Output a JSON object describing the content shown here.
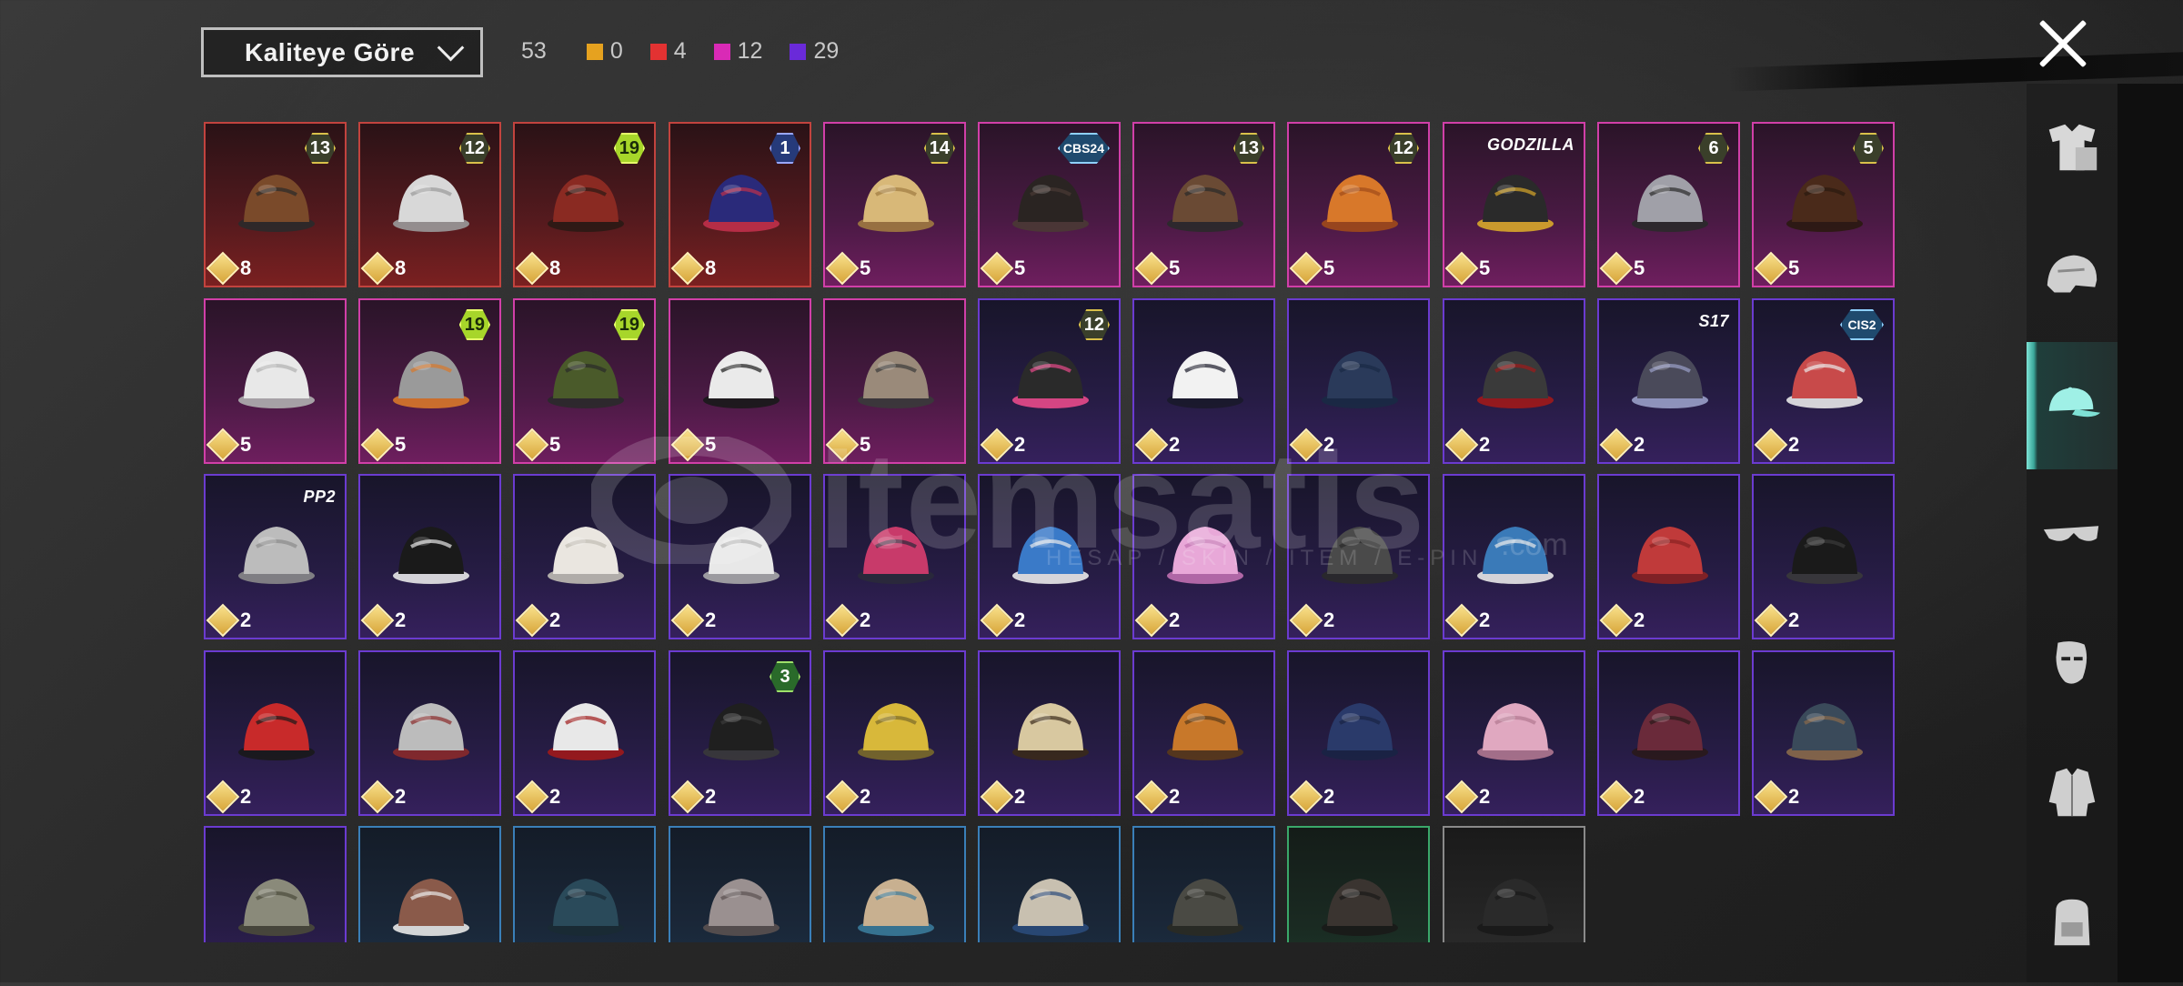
{
  "toolbar": {
    "sort_label": "Kaliteye Göre",
    "total_count": "53",
    "quality_counts": [
      {
        "color": "#e6a21f",
        "count": "0"
      },
      {
        "color": "#e33232",
        "count": "4"
      },
      {
        "color": "#d92ab6",
        "count": "12"
      },
      {
        "color": "#6a2ad9",
        "count": "29"
      }
    ]
  },
  "watermark": {
    "brand": "itemsatis",
    "sub": "HESAP / SKIN / ITEM / E-PIN",
    "domain": ".com"
  },
  "sidebar": {
    "items": [
      {
        "icon": "outfit-icon",
        "active": false
      },
      {
        "icon": "helmet-icon",
        "active": false
      },
      {
        "icon": "cap-icon",
        "active": true
      },
      {
        "icon": "glasses-icon",
        "active": false
      },
      {
        "icon": "mask-icon",
        "active": false
      },
      {
        "icon": "jacket-icon",
        "active": false
      },
      {
        "icon": "backpack-icon",
        "active": false
      }
    ]
  },
  "items": [
    {
      "row": 0,
      "col": 0,
      "rarity": "red",
      "badge": "13",
      "badge_style": "gold",
      "price": "8",
      "art": "brown-hat-hair"
    },
    {
      "row": 0,
      "col": 1,
      "rarity": "red",
      "badge": "12",
      "badge_style": "gold",
      "price": "8",
      "art": "white-hair"
    },
    {
      "row": 0,
      "col": 2,
      "rarity": "red",
      "badge": "19",
      "badge_style": "lime",
      "price": "8",
      "art": "samurai-helmet"
    },
    {
      "row": 0,
      "col": 3,
      "rarity": "red",
      "badge": "1",
      "badge_style": "blue",
      "price": "8",
      "art": "blue-helmet"
    },
    {
      "row": 0,
      "col": 4,
      "rarity": "pink",
      "badge": "14",
      "badge_style": "gold",
      "price": "5",
      "art": "blonde-hair"
    },
    {
      "row": 0,
      "col": 5,
      "rarity": "pink",
      "badge": "CBS24",
      "badge_style": "cbs",
      "price": "5",
      "art": "black-hair"
    },
    {
      "row": 0,
      "col": 6,
      "rarity": "pink",
      "badge": "13",
      "badge_style": "gold",
      "price": "5",
      "art": "goggles-hair"
    },
    {
      "row": 0,
      "col": 7,
      "rarity": "pink",
      "badge": "12",
      "badge_style": "gold",
      "price": "5",
      "art": "orange-hair"
    },
    {
      "row": 0,
      "col": 8,
      "rarity": "pink",
      "badge": "GODZILLA",
      "badge_style": "text",
      "price": "5",
      "art": "spiked-cap"
    },
    {
      "row": 0,
      "col": 9,
      "rarity": "pink",
      "badge": "6",
      "badge_style": "gold",
      "price": "5",
      "art": "silver-helmet"
    },
    {
      "row": 0,
      "col": 10,
      "rarity": "pink",
      "badge": "5",
      "badge_style": "gold",
      "price": "5",
      "art": "pigtails"
    },
    {
      "row": 1,
      "col": 0,
      "rarity": "pink",
      "badge": "",
      "badge_style": "",
      "price": "5",
      "art": "white-braid"
    },
    {
      "row": 1,
      "col": 1,
      "rarity": "pink",
      "badge": "19",
      "badge_style": "lime",
      "price": "5",
      "art": "cat-headphones"
    },
    {
      "row": 1,
      "col": 2,
      "rarity": "pink",
      "badge": "19",
      "badge_style": "lime",
      "price": "5",
      "art": "frog-head"
    },
    {
      "row": 1,
      "col": 3,
      "rarity": "pink",
      "badge": "",
      "badge_style": "",
      "price": "5",
      "art": "piano-hat"
    },
    {
      "row": 1,
      "col": 4,
      "rarity": "pink",
      "badge": "",
      "badge_style": "",
      "price": "5",
      "art": "skull-hair"
    },
    {
      "row": 1,
      "col": 5,
      "rarity": "purple",
      "badge": "12",
      "badge_style": "gold",
      "price": "2",
      "art": "bunny-helmet"
    },
    {
      "row": 1,
      "col": 6,
      "rarity": "purple",
      "badge": "",
      "badge_style": "",
      "price": "2",
      "art": "sun-hat"
    },
    {
      "row": 1,
      "col": 7,
      "rarity": "purple",
      "badge": "",
      "badge_style": "",
      "price": "2",
      "art": "blue-beanie"
    },
    {
      "row": 1,
      "col": 8,
      "rarity": "purple",
      "badge": "",
      "badge_style": "",
      "price": "2",
      "art": "bucket-hat"
    },
    {
      "row": 1,
      "col": 9,
      "rarity": "purple",
      "badge": "S17",
      "badge_style": "text",
      "price": "2",
      "art": "horned-helmet"
    },
    {
      "row": 1,
      "col": 10,
      "rarity": "purple",
      "badge": "CIS2",
      "badge_style": "cbs",
      "price": "2",
      "art": "flag-cap"
    },
    {
      "row": 2,
      "col": 0,
      "rarity": "purple",
      "badge": "PP2",
      "badge_style": "text",
      "price": "2",
      "art": "silver-bob"
    },
    {
      "row": 2,
      "col": 1,
      "rarity": "purple",
      "badge": "",
      "badge_style": "",
      "price": "2",
      "art": "black-braids"
    },
    {
      "row": 2,
      "col": 2,
      "rarity": "purple",
      "badge": "",
      "badge_style": "",
      "price": "2",
      "art": "knit-beanie"
    },
    {
      "row": 2,
      "col": 3,
      "rarity": "purple",
      "badge": "",
      "badge_style": "",
      "price": "2",
      "art": "white-hood"
    },
    {
      "row": 2,
      "col": 4,
      "rarity": "purple",
      "badge": "",
      "badge_style": "",
      "price": "2",
      "art": "moto-helmet"
    },
    {
      "row": 2,
      "col": 5,
      "rarity": "purple",
      "badge": "",
      "badge_style": "",
      "price": "2",
      "art": "pom-hat"
    },
    {
      "row": 2,
      "col": 6,
      "rarity": "purple",
      "badge": "",
      "badge_style": "",
      "price": "2",
      "art": "cat-ear-phones"
    },
    {
      "row": 2,
      "col": 7,
      "rarity": "purple",
      "badge": "",
      "badge_style": "",
      "price": "2",
      "art": "army-helmet"
    },
    {
      "row": 2,
      "col": 8,
      "rarity": "purple",
      "badge": "",
      "badge_style": "",
      "price": "2",
      "art": "shark-hat"
    },
    {
      "row": 2,
      "col": 9,
      "rarity": "purple",
      "badge": "",
      "badge_style": "",
      "price": "2",
      "art": "red-beret"
    },
    {
      "row": 2,
      "col": 10,
      "rarity": "purple",
      "badge": "",
      "badge_style": "",
      "price": "2",
      "art": "black-tophat"
    },
    {
      "row": 3,
      "col": 0,
      "rarity": "purple",
      "badge": "",
      "badge_style": "",
      "price": "2",
      "art": "red-fedora"
    },
    {
      "row": 3,
      "col": 1,
      "rarity": "purple",
      "badge": "",
      "badge_style": "",
      "price": "2",
      "art": "shark-head"
    },
    {
      "row": 3,
      "col": 2,
      "rarity": "purple",
      "badge": "",
      "badge_style": "",
      "price": "2",
      "art": "football-helmet"
    },
    {
      "row": 3,
      "col": 3,
      "rarity": "purple",
      "badge": "3",
      "badge_style": "green",
      "price": "2",
      "art": "black-fedora"
    },
    {
      "row": 3,
      "col": 4,
      "rarity": "purple",
      "badge": "",
      "badge_style": "",
      "price": "2",
      "art": "corn-hat"
    },
    {
      "row": 3,
      "col": 5,
      "rarity": "purple",
      "badge": "",
      "badge_style": "",
      "price": "2",
      "art": "cake-hat"
    },
    {
      "row": 3,
      "col": 6,
      "rarity": "purple",
      "badge": "",
      "badge_style": "",
      "price": "2",
      "art": "burger-hat"
    },
    {
      "row": 3,
      "col": 7,
      "rarity": "purple",
      "badge": "",
      "badge_style": "",
      "price": "2",
      "art": "navy-cap"
    },
    {
      "row": 3,
      "col": 8,
      "rarity": "purple",
      "badge": "",
      "badge_style": "",
      "price": "2",
      "art": "pink-cap"
    },
    {
      "row": 3,
      "col": 9,
      "rarity": "purple",
      "badge": "",
      "badge_style": "",
      "price": "2",
      "art": "maroon-fedora"
    },
    {
      "row": 3,
      "col": 10,
      "rarity": "purple",
      "badge": "",
      "badge_style": "",
      "price": "2",
      "art": "aviator-hat"
    },
    {
      "row": 4,
      "col": 0,
      "rarity": "purple",
      "badge": "",
      "badge_style": "",
      "price": "",
      "art": "camo-boonie"
    },
    {
      "row": 4,
      "col": 1,
      "rarity": "blue",
      "badge": "",
      "badge_style": "",
      "price": "",
      "art": "bandage-helmet"
    },
    {
      "row": 4,
      "col": 2,
      "rarity": "blue",
      "badge": "",
      "badge_style": "",
      "price": "",
      "art": "teal-beret"
    },
    {
      "row": 4,
      "col": 3,
      "rarity": "blue",
      "badge": "",
      "badge_style": "",
      "price": "",
      "art": "gray-beret"
    },
    {
      "row": 4,
      "col": 4,
      "rarity": "blue",
      "badge": "",
      "badge_style": "",
      "price": "",
      "art": "baseball-cap"
    },
    {
      "row": 4,
      "col": 5,
      "rarity": "blue",
      "badge": "",
      "badge_style": "",
      "price": "",
      "art": "blue-cap"
    },
    {
      "row": 4,
      "col": 6,
      "rarity": "blue",
      "badge": "",
      "badge_style": "",
      "price": "",
      "art": "camo-cap"
    },
    {
      "row": 4,
      "col": 7,
      "rarity": "green",
      "badge": "",
      "badge_style": "",
      "price": "",
      "art": "brown-cap"
    },
    {
      "row": 4,
      "col": 8,
      "rarity": "gray",
      "badge": "",
      "badge_style": "",
      "price": "",
      "art": "black-beanie"
    }
  ]
}
